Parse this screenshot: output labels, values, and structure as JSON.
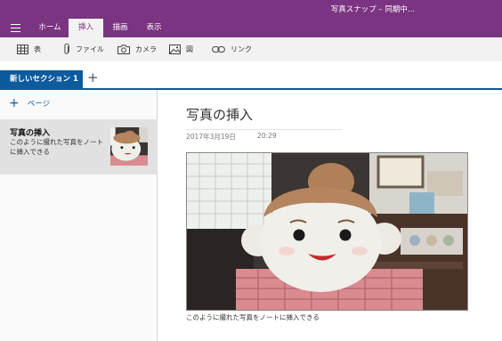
{
  "window": {
    "title": "写真スナップ – 同期中..."
  },
  "menu": {
    "tabs": [
      {
        "label": "ホーム",
        "active": false
      },
      {
        "label": "挿入",
        "active": true
      },
      {
        "label": "描画",
        "active": false
      },
      {
        "label": "表示",
        "active": false
      }
    ]
  },
  "ribbon": {
    "items": [
      {
        "label": "表",
        "icon": "table-icon"
      },
      {
        "label": "ファイル",
        "icon": "paperclip-icon"
      },
      {
        "label": "カメラ",
        "icon": "camera-icon"
      },
      {
        "label": "図",
        "icon": "picture-icon"
      },
      {
        "label": "リンク",
        "icon": "link-icon"
      }
    ]
  },
  "sections": {
    "active_label": "新しいセクション 1",
    "add_label": "+"
  },
  "pages": {
    "add_label": "ページ",
    "items": [
      {
        "title": "写真の挿入",
        "snippet": "このように撮れた写真をノートに挿入できる"
      }
    ]
  },
  "note": {
    "title": "写真の挿入",
    "date": "2017年3月19日",
    "time": "20:29",
    "caption": "このように撮れた写真をノートに挿入できる"
  },
  "colors": {
    "brand_purple": "#7b3481",
    "section_blue": "#0b5b9e",
    "ribbon_bg": "#f2f2f2",
    "selected_page_bg": "#e1e1e1"
  }
}
